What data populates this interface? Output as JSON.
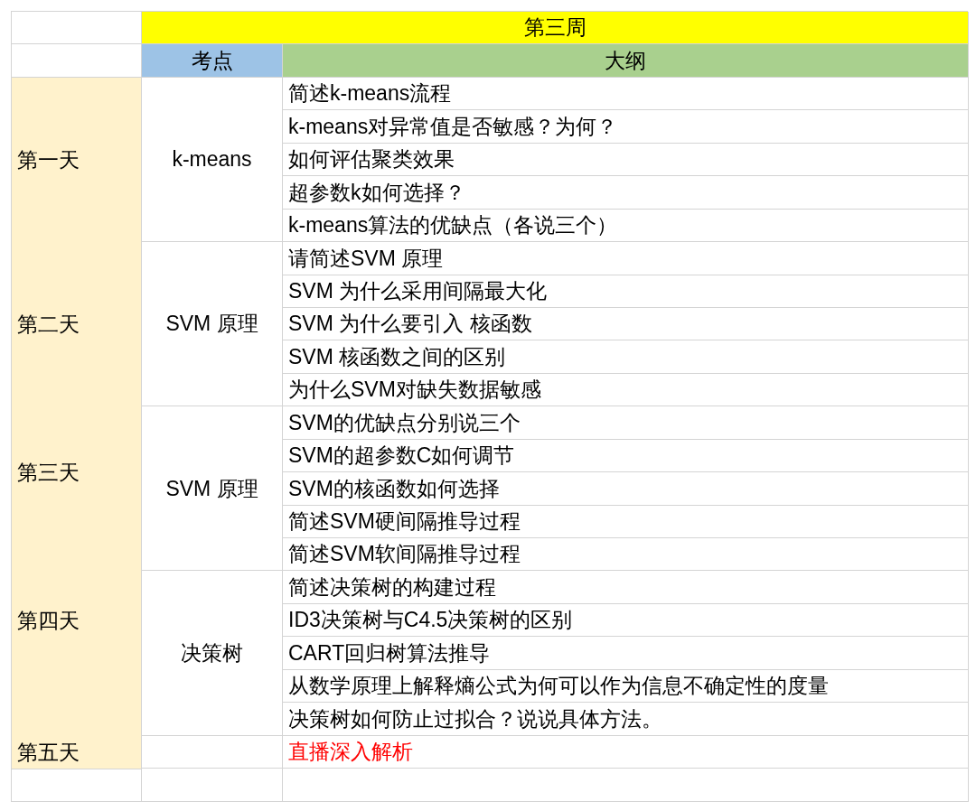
{
  "week_title": "第三周",
  "headers": {
    "topic": "考点",
    "outline": "大纲"
  },
  "sections": [
    {
      "day": "第一天",
      "topic": "k-means",
      "items": [
        {
          "text": "简述k-means流程",
          "highlighted": false
        },
        {
          "text": "k-means对异常值是否敏感？为何？",
          "highlighted": false
        },
        {
          "text": "如何评估聚类效果",
          "highlighted": false
        },
        {
          "text": "超参数k如何选择？",
          "highlighted": false
        },
        {
          "text": "k-means算法的优缺点（各说三个）",
          "highlighted": false
        }
      ]
    },
    {
      "day": "第二天",
      "topic": "SVM 原理",
      "items": [
        {
          "text": "请简述SVM 原理",
          "highlighted": false
        },
        {
          "text": "SVM 为什么采用间隔最大化",
          "highlighted": false
        },
        {
          "text": "SVM 为什么要引入 核函数",
          "highlighted": false
        },
        {
          "text": "SVM 核函数之间的区别",
          "highlighted": false
        },
        {
          "text": "为什么SVM对缺失数据敏感",
          "highlighted": false
        }
      ]
    },
    {
      "day": "第三天",
      "topic": "SVM 原理",
      "items": [
        {
          "text": "SVM的优缺点分别说三个",
          "highlighted": false
        },
        {
          "text": "SVM的超参数C如何调节",
          "highlighted": false
        },
        {
          "text": "SVM的核函数如何选择",
          "highlighted": false
        },
        {
          "text": "简述SVM硬间隔推导过程",
          "highlighted": false
        },
        {
          "text": "简述SVM软间隔推导过程",
          "highlighted": false
        }
      ]
    },
    {
      "day": "第四天",
      "topic": "决策树",
      "items": [
        {
          "text": "简述决策树的构建过程",
          "highlighted": false
        },
        {
          "text": "ID3决策树与C4.5决策树的区别",
          "highlighted": false
        },
        {
          "text": "CART回归树算法推导",
          "highlighted": false
        },
        {
          "text": "从数学原理上解释熵公式为何可以作为信息不确定性的度量",
          "highlighted": false
        },
        {
          "text": "决策树如何防止过拟合？说说具体方法。",
          "highlighted": false
        }
      ]
    },
    {
      "day": "第五天",
      "items": [
        {
          "text": "直播深入解析",
          "highlighted": true
        }
      ]
    }
  ]
}
